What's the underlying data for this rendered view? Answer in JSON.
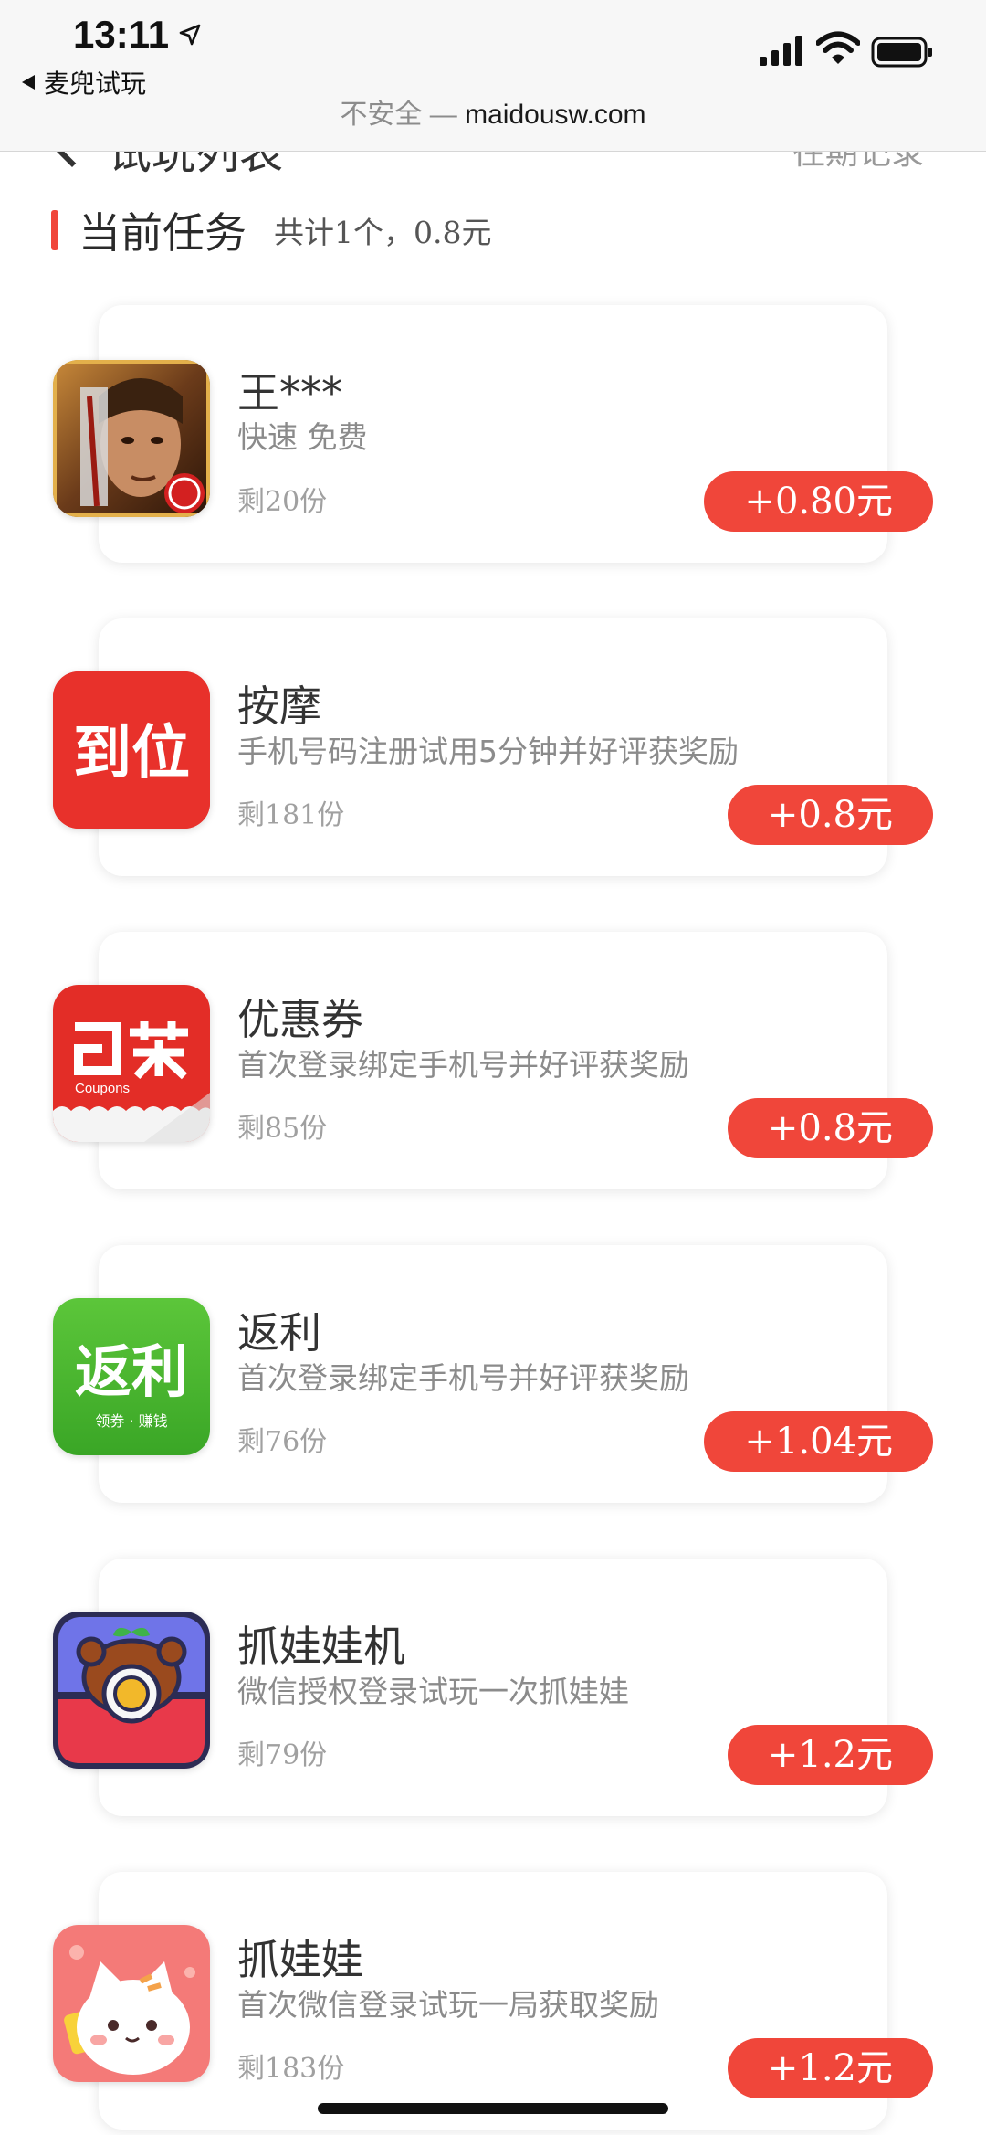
{
  "status": {
    "time": "13:11",
    "back_app": "麦兜试玩"
  },
  "browser": {
    "insecure_label": "不安全 —",
    "domain": "maidousw.com"
  },
  "page": {
    "title": "试玩列表",
    "right_link": "往期记录"
  },
  "section": {
    "label": "当前任务",
    "summary": "共计1个，0.8元"
  },
  "colors": {
    "accent": "#f0463a"
  },
  "tasks": [
    {
      "name": "王***",
      "desc": "快速 免费",
      "left": "剩20份",
      "reward": "+0.80元",
      "icon": "game-warrior-icon"
    },
    {
      "name": "按摩",
      "desc": "手机号码注册试用5分钟并好评获奖励",
      "left": "剩181份",
      "reward": "+0.8元",
      "icon": "daowei-app-icon",
      "icon_text": "到位"
    },
    {
      "name": "优惠券",
      "desc": "首次登录绑定手机号并好评获奖励",
      "left": "剩85份",
      "reward": "+0.8元",
      "icon": "coupons-app-icon",
      "icon_text": "Coupons"
    },
    {
      "name": "返利",
      "desc": "首次登录绑定手机号并好评获奖励",
      "left": "剩76份",
      "reward": "+1.04元",
      "icon": "fanli-app-icon",
      "icon_text": "返利",
      "icon_sub": "领券 · 赚钱"
    },
    {
      "name": "抓娃娃机",
      "desc": "微信授权登录试玩一次抓娃娃",
      "left": "剩79份",
      "reward": "+1.2元",
      "icon": "claw-machine-app-icon"
    },
    {
      "name": "抓娃娃",
      "desc": "首次微信登录试玩一局获取奖励",
      "left": "剩183份",
      "reward": "+1.2元",
      "icon": "cat-app-icon"
    }
  ]
}
